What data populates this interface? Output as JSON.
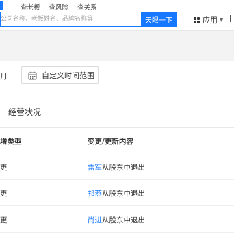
{
  "header": {
    "search_tabs": [
      "查老板",
      "查风险",
      "查关系"
    ],
    "search_placeholder": "公司名称、老板姓名、品牌名称等",
    "search_button": "天眼一下",
    "apps_label": "应用"
  },
  "filter": {
    "month_label": "月",
    "custom_range_label": "自定义时间范围"
  },
  "section": {
    "title": "经营状况"
  },
  "table": {
    "headers": {
      "change_type": "增类型",
      "content": "变更/更新内容"
    },
    "rows": [
      {
        "type": "更",
        "person": "雷军",
        "action": "从股东中退出"
      },
      {
        "type": "更",
        "person": "祁燕",
        "action": "从股东中退出"
      },
      {
        "type": "更",
        "person": "尚进",
        "action": "从股东中退出"
      }
    ]
  },
  "colors": {
    "accent": "#1677ff",
    "band": "#f3f3f3"
  }
}
